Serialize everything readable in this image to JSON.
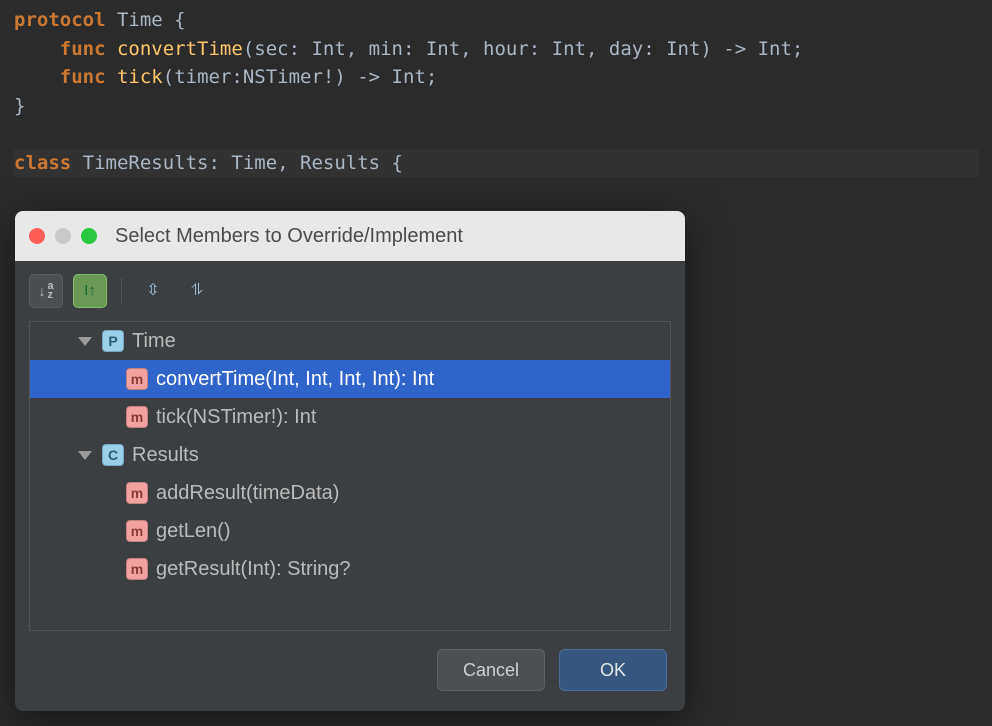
{
  "code": {
    "l1_kw": "protocol",
    "l1_name": "Time",
    "l1_open": " {",
    "l2_kw": "func",
    "l2_name": "convertTime",
    "l2_sig": "(sec: Int, min: Int, hour: Int, day: Int) -> Int;",
    "l3_kw": "func",
    "l3_name": "tick",
    "l3_sig": "(timer:NSTimer!) -> Int;",
    "l4": "}",
    "l6_kw": "class",
    "l6_name": "TimeResults",
    "l6_rest": ": Time, Results {"
  },
  "dialog": {
    "title": "Select Members to Override/Implement",
    "toolbar": {
      "sort_alpha": "a z",
      "sort_up": "I↑"
    },
    "tree": [
      {
        "icon": "P",
        "label": "Time",
        "expanded": true,
        "children": [
          {
            "icon": "m",
            "label": "convertTime(Int, Int, Int, Int): Int",
            "selected": true
          },
          {
            "icon": "m",
            "label": "tick(NSTimer!): Int"
          }
        ]
      },
      {
        "icon": "C",
        "label": "Results",
        "expanded": true,
        "children": [
          {
            "icon": "m",
            "label": "addResult(timeData)"
          },
          {
            "icon": "m",
            "label": "getLen()"
          },
          {
            "icon": "m",
            "label": "getResult(Int): String?"
          }
        ]
      }
    ],
    "buttons": {
      "cancel": "Cancel",
      "ok": "OK"
    }
  }
}
